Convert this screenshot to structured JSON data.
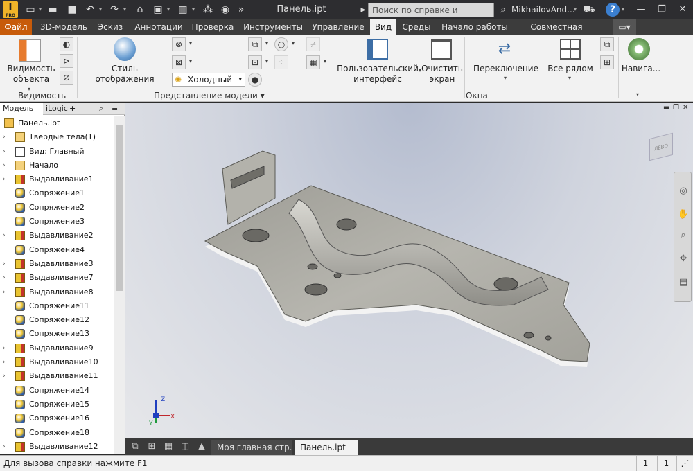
{
  "titlebar": {
    "app_logo": "I",
    "app_logo_sub": "PRO",
    "document_title": "Панель.ipt",
    "search_placeholder": "Поиск по справке и командам",
    "user": "MikhailovAnd...",
    "help": "?",
    "minimize": "—",
    "restore": "❐",
    "close": "✕"
  },
  "menu": {
    "tabs": [
      "Файл",
      "3D-модель",
      "Эскиз",
      "Аннотации",
      "Проверка",
      "Инструменты",
      "Управление",
      "Вид",
      "Среды",
      "Начало работы",
      "Совместная работа"
    ],
    "active": "Вид"
  },
  "ribbon": {
    "visibility_button": [
      "Видимость",
      "объекта"
    ],
    "visibility_panel": "Видимость",
    "display_style": "Стиль отображения",
    "visual_style_value": "Холодный",
    "model_panel": "Представление модели ▾",
    "user_interface": [
      "Пользовательский",
      "интерфейс"
    ],
    "clean_screen": [
      "Очистить",
      "экран"
    ],
    "switch": "Переключение",
    "arrange_all": "Все рядом",
    "navigate": "Навига...",
    "windows_panel": "Окна"
  },
  "browser": {
    "tab_model": "Модель",
    "tab_close": "✕",
    "tab_ilogic": "iLogic",
    "tab_add": "+",
    "tree": [
      {
        "label": "Панель.ipt",
        "icon": "part",
        "level": 0,
        "arrow": false
      },
      {
        "label": "Твердые тела(1)",
        "icon": "solid-bodies",
        "level": 1,
        "arrow": true
      },
      {
        "label": "Вид: Главный",
        "icon": "view",
        "level": 1,
        "arrow": true
      },
      {
        "label": "Начало",
        "icon": "folder",
        "level": 1,
        "arrow": true
      },
      {
        "label": "Выдавливание1",
        "icon": "extrude",
        "level": 1,
        "arrow": true
      },
      {
        "label": "Сопряжение1",
        "icon": "fillet",
        "level": 1,
        "arrow": false
      },
      {
        "label": "Сопряжение2",
        "icon": "fillet",
        "level": 1,
        "arrow": false
      },
      {
        "label": "Сопряжение3",
        "icon": "fillet",
        "level": 1,
        "arrow": false
      },
      {
        "label": "Выдавливание2",
        "icon": "extrude",
        "level": 1,
        "arrow": true
      },
      {
        "label": "Сопряжение4",
        "icon": "fillet",
        "level": 1,
        "arrow": false
      },
      {
        "label": "Выдавливание3",
        "icon": "extrude",
        "level": 1,
        "arrow": true
      },
      {
        "label": "Выдавливание7",
        "icon": "extrude",
        "level": 1,
        "arrow": true
      },
      {
        "label": "Выдавливание8",
        "icon": "extrude",
        "level": 1,
        "arrow": true
      },
      {
        "label": "Сопряжение11",
        "icon": "fillet",
        "level": 1,
        "arrow": false
      },
      {
        "label": "Сопряжение12",
        "icon": "fillet",
        "level": 1,
        "arrow": false
      },
      {
        "label": "Сопряжение13",
        "icon": "fillet",
        "level": 1,
        "arrow": false
      },
      {
        "label": "Выдавливание9",
        "icon": "extrude",
        "level": 1,
        "arrow": true
      },
      {
        "label": "Выдавливание10",
        "icon": "extrude",
        "level": 1,
        "arrow": true
      },
      {
        "label": "Выдавливание11",
        "icon": "extrude",
        "level": 1,
        "arrow": true
      },
      {
        "label": "Сопряжение14",
        "icon": "fillet",
        "level": 1,
        "arrow": false
      },
      {
        "label": "Сопряжение15",
        "icon": "fillet",
        "level": 1,
        "arrow": false
      },
      {
        "label": "Сопряжение16",
        "icon": "fillet",
        "level": 1,
        "arrow": false
      },
      {
        "label": "Сопряжение18",
        "icon": "fillet",
        "level": 1,
        "arrow": false
      },
      {
        "label": "Выдавливание12",
        "icon": "extrude",
        "level": 1,
        "arrow": true
      }
    ]
  },
  "viewport": {
    "viewcube_label": "ЛЕВО",
    "triad": {
      "x": "X",
      "y": "Y",
      "z": "Z"
    }
  },
  "doc_tabs": {
    "home_tab": "Моя главная стр...",
    "part_tab": "Панель.ipt",
    "close": "✕",
    "arrow": "▲"
  },
  "statusbar": {
    "hint": "Для вызова справки нажмите F1",
    "count1": "1",
    "count2": "1"
  },
  "colors": {
    "file_tab": "#c75b0a",
    "titlebar": "#2d2d30",
    "ribbon": "#f2f2f2",
    "model": "#b9b8b0"
  }
}
